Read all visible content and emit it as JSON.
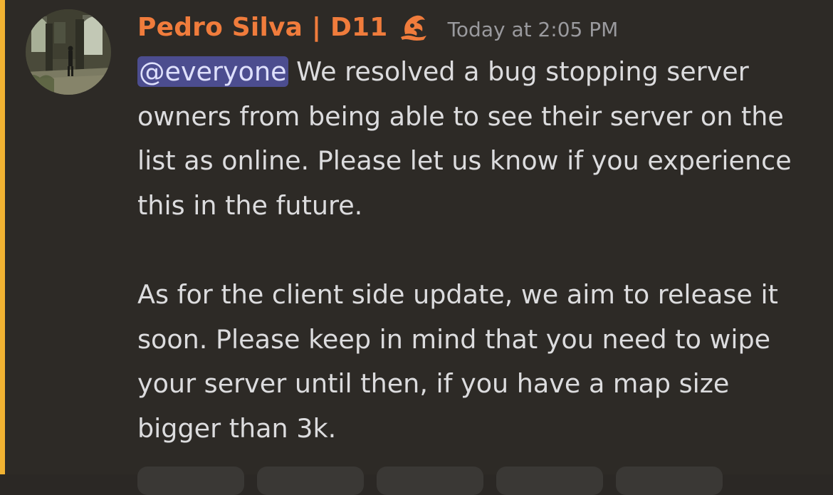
{
  "message": {
    "author": "Pedro Silva | D11",
    "timestamp": "Today at 2:05 PM",
    "mention": "@everyone",
    "text_after_mention": " We resolved a bug stopping server owners from being able to see their server on the list as online. Please let us know if you experience this in the future.",
    "paragraph_2": "As for the client side update, we aim to release it soon. Please keep in mind that you need to wipe your server until then, if you have a map size bigger than 3k.",
    "role_icon": "wizard-hat-icon",
    "author_color": "#f07c3c",
    "mention_bg": "#4c4d8f",
    "mention_bar_color": "#f0b232"
  },
  "reactions": [
    {
      "icon": "reaction-emoji"
    },
    {
      "icon": "reaction-emoji"
    },
    {
      "icon": "reaction-emoji"
    },
    {
      "icon": "reaction-emoji"
    },
    {
      "icon": "reaction-emoji"
    }
  ]
}
